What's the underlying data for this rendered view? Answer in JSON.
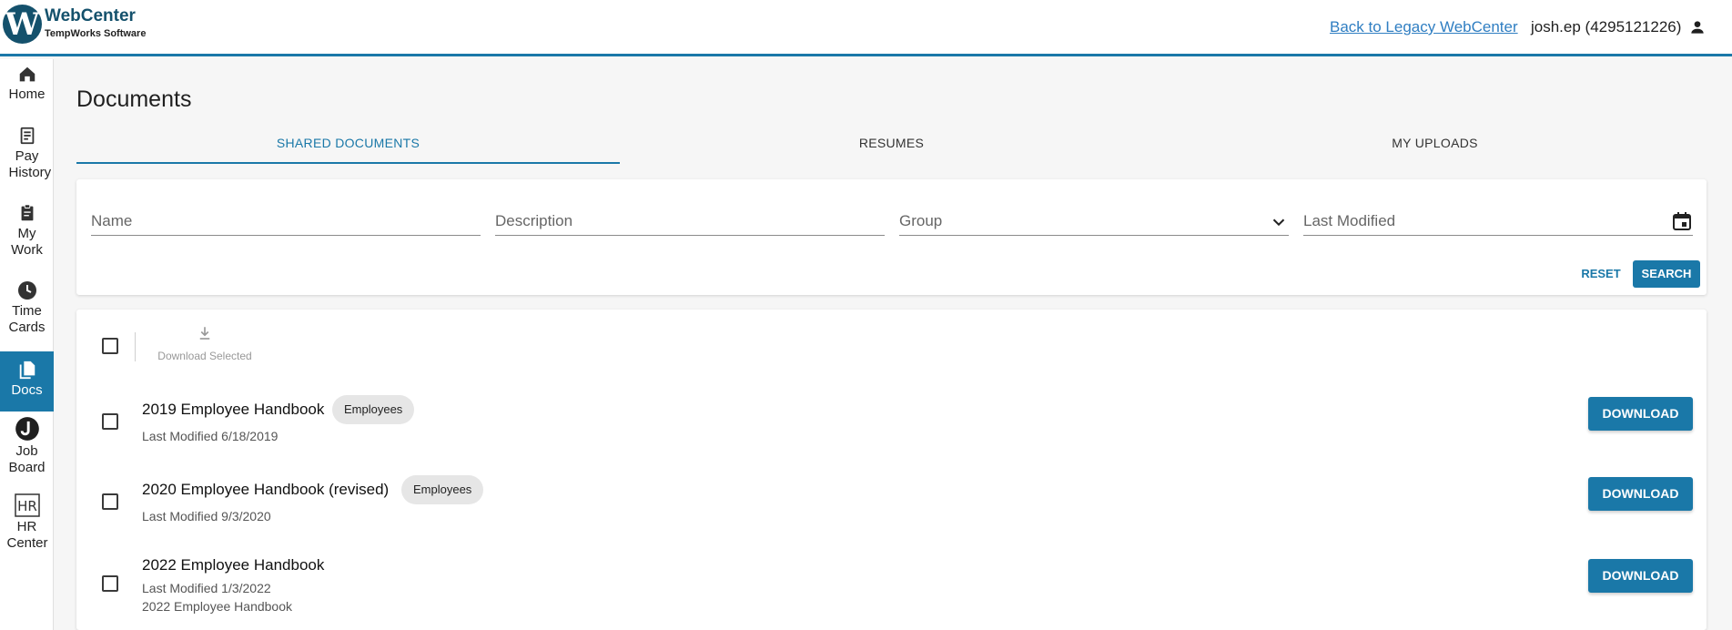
{
  "header": {
    "logo_title": "WebCenter",
    "logo_subtitle": "TempWorks Software",
    "logo_letter": "W",
    "legacy_link": "Back to Legacy WebCenter",
    "user": "josh.ep (4295121226)"
  },
  "sidebar": {
    "items": [
      {
        "label": "Home",
        "icon": "home-icon"
      },
      {
        "label": "Pay History",
        "icon": "receipt-icon"
      },
      {
        "label": "My Work",
        "icon": "clipboard-icon"
      },
      {
        "label": "Time Cards",
        "icon": "clock-icon"
      },
      {
        "label": "Docs",
        "icon": "documents-icon",
        "active": true
      },
      {
        "label": "Job Board",
        "icon": "job-board-icon"
      },
      {
        "label": "HR Center",
        "icon": "hr-icon",
        "icon_text": "HR"
      }
    ]
  },
  "page": {
    "title": "Documents",
    "tabs": [
      {
        "label": "SHARED DOCUMENTS",
        "active": true
      },
      {
        "label": "RESUMES",
        "active": false
      },
      {
        "label": "MY UPLOADS",
        "active": false
      }
    ]
  },
  "filters": {
    "name_label": "Name",
    "description_label": "Description",
    "group_label": "Group",
    "last_modified_label": "Last Modified",
    "reset_label": "RESET",
    "search_label": "SEARCH"
  },
  "list": {
    "download_selected_label": "Download Selected",
    "download_label": "DOWNLOAD",
    "documents": [
      {
        "name": "2019 Employee Handbook",
        "group": "Employees",
        "modified": "Last Modified 6/18/2019",
        "description": ""
      },
      {
        "name": "2020 Employee Handbook (revised)",
        "group": "Employees",
        "modified": "Last Modified 9/3/2020",
        "description": ""
      },
      {
        "name": "2022 Employee Handbook",
        "group": "",
        "modified": "Last Modified 1/3/2022",
        "description": "2022 Employee Handbook"
      }
    ]
  },
  "colors": {
    "accent": "#1a78a8",
    "logo": "#14516c",
    "link": "#2f7ec2"
  }
}
